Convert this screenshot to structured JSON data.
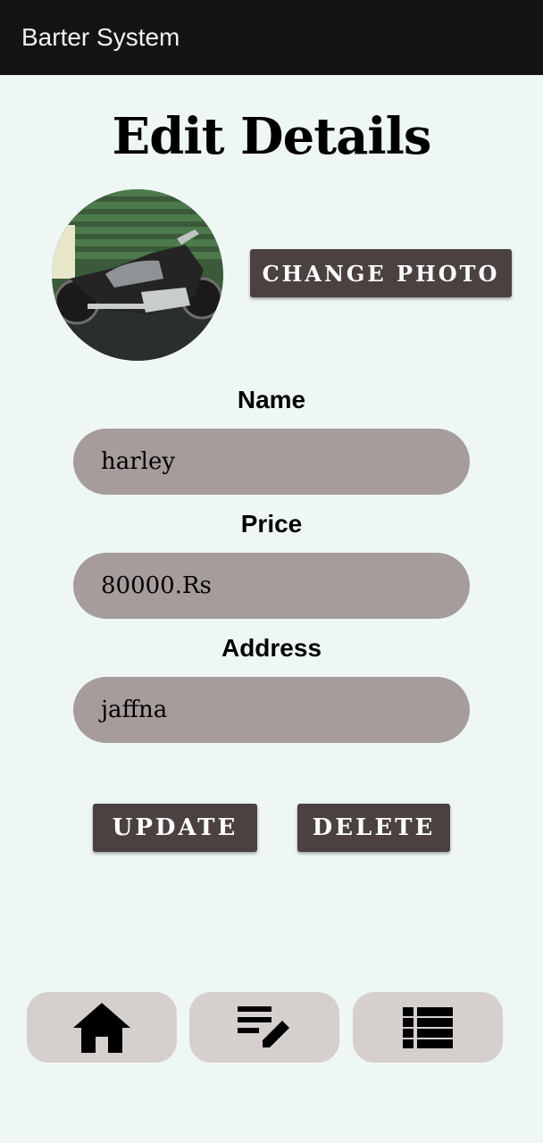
{
  "appbar": {
    "title": "Barter System"
  },
  "page": {
    "title": "Edit Details"
  },
  "photo": {
    "change_label": "CHANGE PHOTO"
  },
  "fields": {
    "name": {
      "label": "Name",
      "value": "harley"
    },
    "price": {
      "label": "Price",
      "value": "80000.Rs"
    },
    "address": {
      "label": "Address",
      "value": "jaffna"
    }
  },
  "actions": {
    "update_label": "UPDATE",
    "delete_label": "DELETE"
  },
  "bottom_nav": {
    "items": [
      {
        "icon": "home-icon"
      },
      {
        "icon": "edit-list-icon"
      },
      {
        "icon": "list-icon"
      }
    ]
  },
  "colors": {
    "background": "#eff7f5",
    "appbar": "#141414",
    "button": "#4b4140",
    "field": "#a69c9b",
    "nav_button": "#d5cfcd"
  }
}
